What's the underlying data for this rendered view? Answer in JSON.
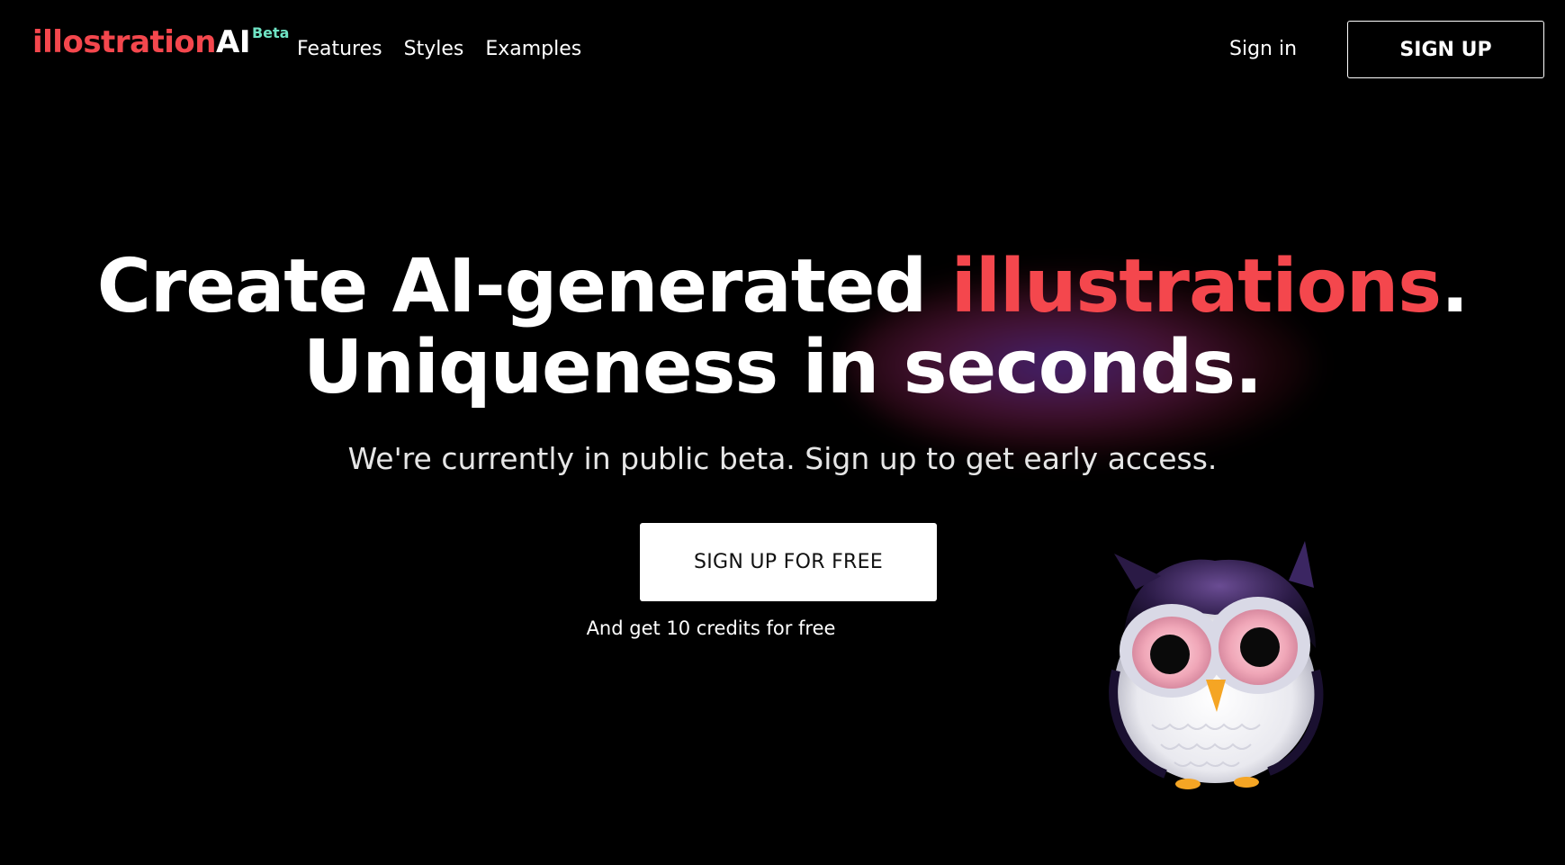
{
  "brand": {
    "name_part1": "illostration",
    "name_part2": "AI",
    "badge": "Beta",
    "colors": {
      "accent": "#f4474d",
      "badge": "#6fe3c4",
      "background": "#000000"
    }
  },
  "nav": {
    "items": [
      {
        "label": "Features"
      },
      {
        "label": "Styles"
      },
      {
        "label": "Examples"
      }
    ],
    "signin_label": "Sign in",
    "signup_label": "SIGN UP"
  },
  "hero": {
    "title_line1_prefix": "Create AI-generated ",
    "title_line1_accent": "illustrations",
    "title_line1_suffix": ".",
    "title_line2": "Uniqueness in seconds.",
    "subtitle": "We're currently in public beta. Sign up to get early access.",
    "cta_label": "SIGN UP FOR FREE",
    "cta_note": "And get 10 credits for free"
  },
  "illustration": {
    "icon": "owl-mascot-icon"
  }
}
